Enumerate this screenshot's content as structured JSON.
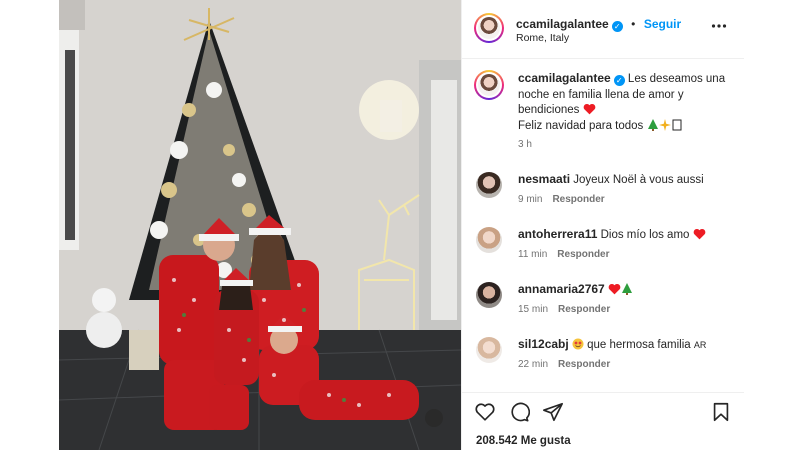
{
  "post": {
    "username": "ccamilagalantee",
    "follow_label": "Seguir",
    "separator": "•",
    "location": "Rome, Italy",
    "caption_line1": "Les deseamos una noche en familia llena de amor y bendiciones",
    "caption_line2": "Feliz navidad para todos",
    "caption_time": "3 h",
    "likes": "208.542 Me gusta"
  },
  "comments": [
    {
      "user": "nesmaati",
      "text": "Joyeux Noël à vous aussi",
      "time": "9 min",
      "reply": "Responder"
    },
    {
      "user": "antoherrera11",
      "text": "Dios mío los amo",
      "time": "11 min",
      "reply": "Responder"
    },
    {
      "user": "annamaria2767",
      "text": "",
      "time": "15 min",
      "reply": "Responder"
    },
    {
      "user": "sil12cabj",
      "text": "que hermosa familia",
      "suffix": "AR",
      "time": "22 min",
      "reply": "Responder"
    }
  ],
  "icons": [
    "verified-badge-icon",
    "more-options-icon",
    "heart-icon",
    "comment-icon",
    "share-icon",
    "bookmark-icon",
    "heart-emoji-icon",
    "tree-emoji-icon",
    "sparkle-emoji-icon",
    "star-struck-emoji-icon"
  ],
  "colors": {
    "link": "#0095f6",
    "heart": "#ed1c24",
    "tree": "#2e9e3e",
    "meta": "#737373"
  }
}
